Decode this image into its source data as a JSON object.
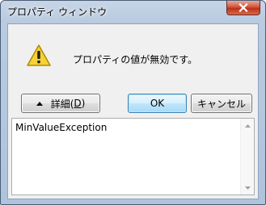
{
  "window": {
    "title": "プロパティ ウィンドウ",
    "close_icon": "close-icon"
  },
  "dialog": {
    "icon": "warning-icon",
    "message": "プロパティの値が無効です。",
    "details_button": {
      "label_prefix": "詳細(",
      "mnemonic": "D",
      "label_suffix": ")",
      "icon": "chevron-up-icon"
    },
    "ok_button": {
      "label": "OK"
    },
    "cancel_button": {
      "label": "キャンセル"
    },
    "details_text": "MinValueException"
  },
  "colors": {
    "warning_fill": "#f7d233",
    "warning_stroke": "#b08a00",
    "close_red": "#c8432b",
    "titlebar": "#b9cbe0"
  }
}
